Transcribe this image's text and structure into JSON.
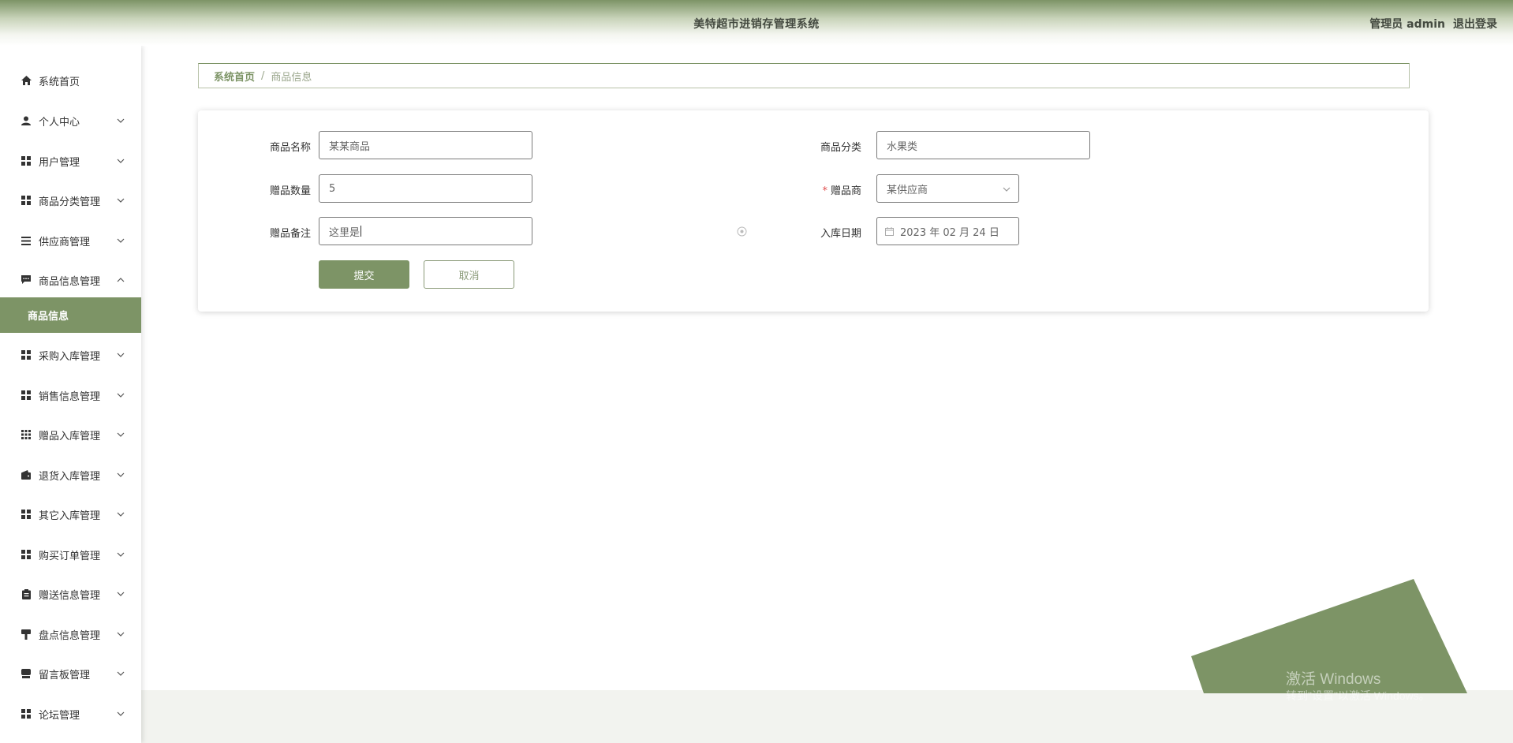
{
  "header": {
    "title": "美特超市进销存管理系统",
    "user": "管理员 admin",
    "logout": "退出登录"
  },
  "sidebar": {
    "items": [
      {
        "label": "系统首页",
        "icon": "home-icon"
      },
      {
        "label": "个人中心",
        "icon": "user-icon"
      },
      {
        "label": "用户管理",
        "icon": "grid-icon"
      },
      {
        "label": "商品分类管理",
        "icon": "grid-icon"
      },
      {
        "label": "供应商管理",
        "icon": "list-icon"
      },
      {
        "label": "商品信息管理",
        "icon": "chat-icon"
      },
      {
        "label": "采购入库管理",
        "icon": "grid-icon"
      },
      {
        "label": "销售信息管理",
        "icon": "grid-icon"
      },
      {
        "label": "赠品入库管理",
        "icon": "apps-icon"
      },
      {
        "label": "退货入库管理",
        "icon": "wallet-icon"
      },
      {
        "label": "其它入库管理",
        "icon": "grid-icon"
      },
      {
        "label": "购买订单管理",
        "icon": "grid-icon"
      },
      {
        "label": "赠送信息管理",
        "icon": "clipboard-icon"
      },
      {
        "label": "盘点信息管理",
        "icon": "brush-icon"
      },
      {
        "label": "留言板管理",
        "icon": "printer-icon"
      },
      {
        "label": "论坛管理",
        "icon": "grid-icon"
      }
    ],
    "active_sub": "商品信息"
  },
  "breadcrumb": {
    "home": "系统首页",
    "separator": "/",
    "current": "商品信息"
  },
  "form": {
    "name_label": "商品名称",
    "name_value": "某某商品",
    "category_label": "商品分类",
    "category_value": "水果类",
    "qty_label": "赠品数量",
    "qty_value": "5",
    "supplier_label": "赠品商",
    "supplier_value": "某供应商",
    "remark_label": "赠品备注",
    "remark_value": "这里是",
    "date_label": "入库日期",
    "date_value": "2023 年 02 月 24 日",
    "submit": "提交",
    "cancel": "取消"
  },
  "watermark": {
    "title": "激活 Windows",
    "subtitle": "转到\"设置\"以激活 Windows。"
  },
  "colors": {
    "accent": "#7d9466",
    "required": "#e04f4f"
  }
}
